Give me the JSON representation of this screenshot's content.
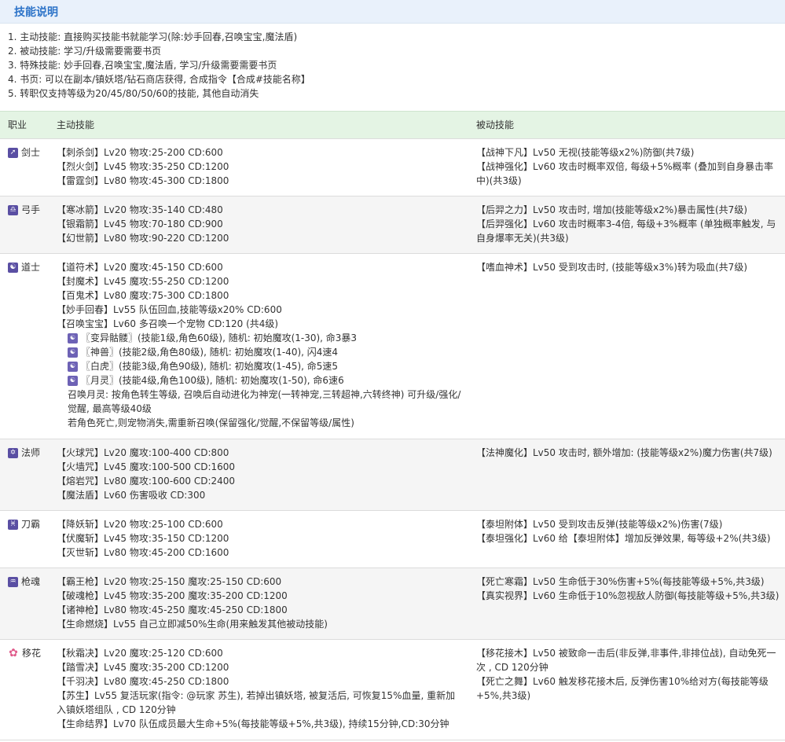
{
  "title": "技能说明",
  "notes": [
    "1. 主动技能: 直接购买技能书就能学习(除:妙手回春,召唤宝宝,魔法盾)",
    "2. 被动技能: 学习/升级需要需要书页",
    "3. 特殊技能: 妙手回春,召唤宝宝,魔法盾, 学习/升级需要需要书页",
    "4. 书页: 可以在副本/镇妖塔/钻石商店获得, 合成指令【合成#技能名称】",
    "5. 转职仅支持等级为20/45/80/50/60的技能, 其他自动消失"
  ],
  "headers": {
    "job": "职业",
    "active": "主动技能",
    "passive": "被动技能"
  },
  "jobs": [
    {
      "name": "剑士",
      "icon": "sword-icon",
      "active": [
        "【刺杀剑】Lv20 物攻:25-200 CD:600",
        "【烈火剑】Lv45 物攻:35-250 CD:1200",
        "【雷霆剑】Lv80 物攻:45-300 CD:1800"
      ],
      "passive": [
        "【战神下凡】Lv50 无视(技能等级x2%)防御(共7级)",
        "【战神强化】Lv60 攻击时概率双倍, 每级+5%概率 (叠加到自身暴击率中)(共3级)"
      ]
    },
    {
      "name": "弓手",
      "icon": "bow-icon",
      "active": [
        "【寒冰箭】Lv20 物攻:35-140 CD:480",
        "【银霜箭】Lv45 物攻:70-180 CD:900",
        "【幻世箭】Lv80 物攻:90-220 CD:1200"
      ],
      "passive": [
        "【后羿之力】Lv50 攻击时, 增加(技能等级x2%)暴击属性(共7级)",
        "【后羿强化】Lv60 攻击时概率3-4倍, 每级+3%概率 (单独概率触发, 与自身爆率无关)(共3级)"
      ]
    },
    {
      "name": "道士",
      "icon": "taoist-icon",
      "active": [
        "【道符术】Lv20 魔攻:45-150 CD:600",
        "【封魔术】Lv45 魔攻:55-250 CD:1200",
        "【百鬼术】Lv80 魔攻:75-300 CD:1800",
        "【妙手回春】Lv55 队伍回血,技能等级x20% CD:600",
        "【召唤宝宝】Lv60 多召唤一个宠物 CD:120 (共4级)"
      ],
      "pets": [
        "〖变异骷髅〗(技能1级,角色60级), 随机: 初始魔攻(1-30), 命3暴3",
        "〖神兽〗(技能2级,角色80级), 随机: 初始魔攻(1-40), 闪4速4",
        "〖白虎〗(技能3级,角色90级), 随机: 初始魔攻(1-45), 命5速5",
        "〖月灵〗(技能4级,角色100级), 随机: 初始魔攻(1-50), 命6速6"
      ],
      "extra": [
        "召唤月灵: 按角色转生等级, 召唤后自动进化为神宠(一转神宠,三转超神,六转终神)      可升级/强化/觉醒, 最高等级40级",
        "若角色死亡,则宠物消失,需重新召唤(保留强化/觉醒,不保留等级/属性)"
      ],
      "passive": [
        "【嗜血神术】Lv50 受到攻击时, (技能等级x3%)转为吸血(共7级)"
      ]
    },
    {
      "name": "法师",
      "icon": "mage-icon",
      "active": [
        "【火球咒】Lv20 魔攻:100-400 CD:800",
        "【火墙咒】Lv45 魔攻:100-500 CD:1600",
        "【熔岩咒】Lv80 魔攻:100-600 CD:2400",
        "【魔法盾】Lv60 伤害吸收 CD:300"
      ],
      "passive": [
        "【法神魔化】Lv50 攻击时, 额外增加: (技能等级x2%)魔力伤害(共7级)"
      ]
    },
    {
      "name": "刀霸",
      "icon": "blade-icon",
      "active": [
        "【降妖斩】Lv20 物攻:25-100 CD:600",
        "【伏魔斩】Lv45 物攻:35-150 CD:1200",
        "【灭世斩】Lv80 物攻:45-200 CD:1600"
      ],
      "passive": [
        "【泰坦附体】Lv50 受到攻击反弹(技能等级x2%)伤害(7级)",
        "【泰坦强化】Lv60 给【泰坦附体】增加反弹效果, 每等级+2%(共3级)"
      ]
    },
    {
      "name": "枪魂",
      "icon": "spear-icon",
      "active": [
        "【霸王枪】Lv20 物攻:25-150 魔攻:25-150 CD:600",
        "【破魂枪】Lv45 物攻:35-200 魔攻:35-200 CD:1200",
        "【诸神枪】Lv80 物攻:45-250 魔攻:45-250 CD:1800",
        "【生命燃烧】Lv55 自己立即减50%生命(用来触发其他被动技能)"
      ],
      "passive": [
        "【死亡寒霜】Lv50 生命低于30%伤害+5%(每技能等级+5%,共3级)",
        "【真实视界】Lv60 生命低于10%忽视敌人防御(每技能等级+5%,共3级)"
      ]
    },
    {
      "name": "移花",
      "icon": "flower-icon",
      "active": [
        "【秋霜决】Lv20 魔攻:25-120 CD:600",
        "【踏雪决】Lv45 魔攻:35-200 CD:1200",
        "【千羽决】Lv80 魔攻:45-250 CD:1800",
        "【苏生】Lv55 复活玩家(指令: @玩家 苏生), 若掉出镇妖塔, 被复活后, 可恢复15%血量, 重新加入镇妖塔组队 , CD 120分钟",
        "【生命结界】Lv70 队伍成员最大生命+5%(每技能等级+5%,共3级), 持续15分钟,CD:30分钟"
      ],
      "passive": [
        "【移花接木】Lv50 被致命一击后(非反弹,非事件,非排位战), 自动免死一次 , CD 120分钟",
        "【死亡之舞】Lv60 触发移花接木后, 反弹伤害10%给对方(每技能等级+5%,共3级)"
      ]
    }
  ]
}
